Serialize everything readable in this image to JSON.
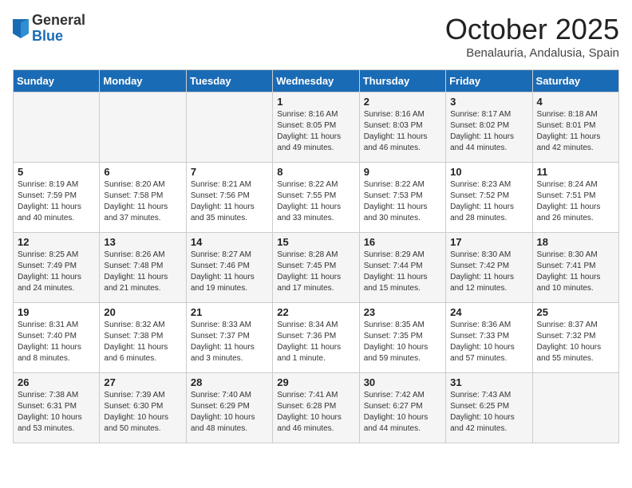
{
  "header": {
    "logo_general": "General",
    "logo_blue": "Blue",
    "month_title": "October 2025",
    "location": "Benalauria, Andalusia, Spain"
  },
  "columns": [
    "Sunday",
    "Monday",
    "Tuesday",
    "Wednesday",
    "Thursday",
    "Friday",
    "Saturday"
  ],
  "weeks": [
    [
      {
        "day": "",
        "info": ""
      },
      {
        "day": "",
        "info": ""
      },
      {
        "day": "",
        "info": ""
      },
      {
        "day": "1",
        "info": "Sunrise: 8:16 AM\nSunset: 8:05 PM\nDaylight: 11 hours\nand 49 minutes."
      },
      {
        "day": "2",
        "info": "Sunrise: 8:16 AM\nSunset: 8:03 PM\nDaylight: 11 hours\nand 46 minutes."
      },
      {
        "day": "3",
        "info": "Sunrise: 8:17 AM\nSunset: 8:02 PM\nDaylight: 11 hours\nand 44 minutes."
      },
      {
        "day": "4",
        "info": "Sunrise: 8:18 AM\nSunset: 8:01 PM\nDaylight: 11 hours\nand 42 minutes."
      }
    ],
    [
      {
        "day": "5",
        "info": "Sunrise: 8:19 AM\nSunset: 7:59 PM\nDaylight: 11 hours\nand 40 minutes."
      },
      {
        "day": "6",
        "info": "Sunrise: 8:20 AM\nSunset: 7:58 PM\nDaylight: 11 hours\nand 37 minutes."
      },
      {
        "day": "7",
        "info": "Sunrise: 8:21 AM\nSunset: 7:56 PM\nDaylight: 11 hours\nand 35 minutes."
      },
      {
        "day": "8",
        "info": "Sunrise: 8:22 AM\nSunset: 7:55 PM\nDaylight: 11 hours\nand 33 minutes."
      },
      {
        "day": "9",
        "info": "Sunrise: 8:22 AM\nSunset: 7:53 PM\nDaylight: 11 hours\nand 30 minutes."
      },
      {
        "day": "10",
        "info": "Sunrise: 8:23 AM\nSunset: 7:52 PM\nDaylight: 11 hours\nand 28 minutes."
      },
      {
        "day": "11",
        "info": "Sunrise: 8:24 AM\nSunset: 7:51 PM\nDaylight: 11 hours\nand 26 minutes."
      }
    ],
    [
      {
        "day": "12",
        "info": "Sunrise: 8:25 AM\nSunset: 7:49 PM\nDaylight: 11 hours\nand 24 minutes."
      },
      {
        "day": "13",
        "info": "Sunrise: 8:26 AM\nSunset: 7:48 PM\nDaylight: 11 hours\nand 21 minutes."
      },
      {
        "day": "14",
        "info": "Sunrise: 8:27 AM\nSunset: 7:46 PM\nDaylight: 11 hours\nand 19 minutes."
      },
      {
        "day": "15",
        "info": "Sunrise: 8:28 AM\nSunset: 7:45 PM\nDaylight: 11 hours\nand 17 minutes."
      },
      {
        "day": "16",
        "info": "Sunrise: 8:29 AM\nSunset: 7:44 PM\nDaylight: 11 hours\nand 15 minutes."
      },
      {
        "day": "17",
        "info": "Sunrise: 8:30 AM\nSunset: 7:42 PM\nDaylight: 11 hours\nand 12 minutes."
      },
      {
        "day": "18",
        "info": "Sunrise: 8:30 AM\nSunset: 7:41 PM\nDaylight: 11 hours\nand 10 minutes."
      }
    ],
    [
      {
        "day": "19",
        "info": "Sunrise: 8:31 AM\nSunset: 7:40 PM\nDaylight: 11 hours\nand 8 minutes."
      },
      {
        "day": "20",
        "info": "Sunrise: 8:32 AM\nSunset: 7:38 PM\nDaylight: 11 hours\nand 6 minutes."
      },
      {
        "day": "21",
        "info": "Sunrise: 8:33 AM\nSunset: 7:37 PM\nDaylight: 11 hours\nand 3 minutes."
      },
      {
        "day": "22",
        "info": "Sunrise: 8:34 AM\nSunset: 7:36 PM\nDaylight: 11 hours\nand 1 minute."
      },
      {
        "day": "23",
        "info": "Sunrise: 8:35 AM\nSunset: 7:35 PM\nDaylight: 10 hours\nand 59 minutes."
      },
      {
        "day": "24",
        "info": "Sunrise: 8:36 AM\nSunset: 7:33 PM\nDaylight: 10 hours\nand 57 minutes."
      },
      {
        "day": "25",
        "info": "Sunrise: 8:37 AM\nSunset: 7:32 PM\nDaylight: 10 hours\nand 55 minutes."
      }
    ],
    [
      {
        "day": "26",
        "info": "Sunrise: 7:38 AM\nSunset: 6:31 PM\nDaylight: 10 hours\nand 53 minutes."
      },
      {
        "day": "27",
        "info": "Sunrise: 7:39 AM\nSunset: 6:30 PM\nDaylight: 10 hours\nand 50 minutes."
      },
      {
        "day": "28",
        "info": "Sunrise: 7:40 AM\nSunset: 6:29 PM\nDaylight: 10 hours\nand 48 minutes."
      },
      {
        "day": "29",
        "info": "Sunrise: 7:41 AM\nSunset: 6:28 PM\nDaylight: 10 hours\nand 46 minutes."
      },
      {
        "day": "30",
        "info": "Sunrise: 7:42 AM\nSunset: 6:27 PM\nDaylight: 10 hours\nand 44 minutes."
      },
      {
        "day": "31",
        "info": "Sunrise: 7:43 AM\nSunset: 6:25 PM\nDaylight: 10 hours\nand 42 minutes."
      },
      {
        "day": "",
        "info": ""
      }
    ]
  ]
}
